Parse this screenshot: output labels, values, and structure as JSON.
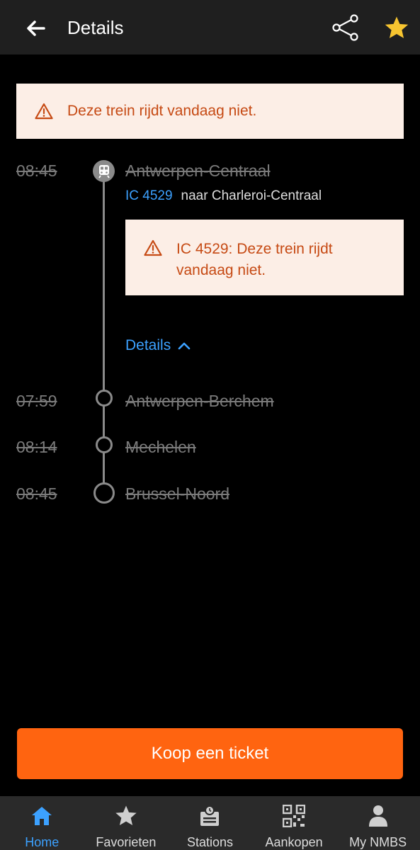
{
  "header": {
    "title": "Details",
    "icons": [
      "arrow-left-icon",
      "share-icon",
      "star-icon"
    ],
    "star_color": "#f7c530"
  },
  "alert_top": {
    "text": "Deze trein rijdt vandaag niet."
  },
  "departure": {
    "time": "08:45",
    "station": "Antwerpen-Centraal",
    "train_number": "IC 4529",
    "destination": "naar Charleroi-Centraal"
  },
  "alert_inner": {
    "text": "IC 4529: Deze trein rijdt vandaag niet."
  },
  "details_link": {
    "label": "Details"
  },
  "stops": [
    {
      "time": "07:59",
      "station": "Antwerpen-Berchem"
    },
    {
      "time": "08:14",
      "station": "Mechelen"
    },
    {
      "time": "08:45",
      "station": "Brussel-Noord"
    }
  ],
  "cta": {
    "label": "Koop een ticket",
    "color": "#ff6410"
  },
  "nav": {
    "items": [
      {
        "label": "Home",
        "icon": "home-icon",
        "active": true
      },
      {
        "label": "Favorieten",
        "icon": "star-icon"
      },
      {
        "label": "Stations",
        "icon": "station-icon"
      },
      {
        "label": "Aankopen",
        "icon": "qr-code-icon"
      },
      {
        "label": "My NMBS",
        "icon": "person-icon"
      }
    ]
  },
  "colors": {
    "accent": "#3ca1ff",
    "alert_bg": "#fceee6",
    "alert_text": "#c64a14"
  }
}
